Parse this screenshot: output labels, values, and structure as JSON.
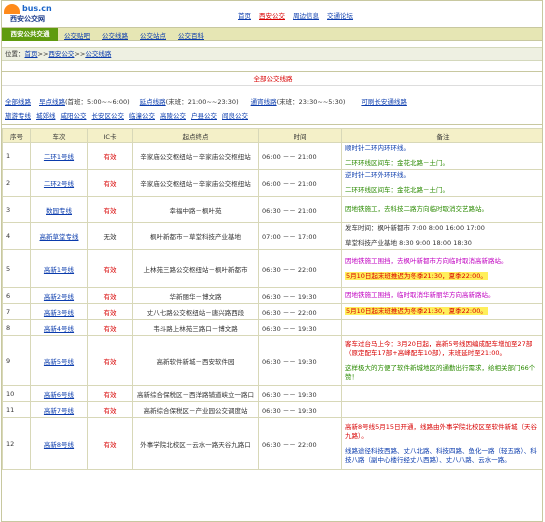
{
  "header": {
    "logo_domain": "bus.cn",
    "logo_name": "西安公交网",
    "nav": [
      "首页",
      "西安公交",
      "周边信息",
      "交通论坛"
    ],
    "nav_active_index": 1
  },
  "subbar": {
    "site_tab": "西安公共交通",
    "items": [
      "公交贴吧",
      "公交线路",
      "公交站点",
      "公交百科"
    ]
  },
  "breadcrumb": {
    "prefix": "位置：",
    "items": [
      "首页",
      "西安公交",
      "公交线路"
    ],
    "sep": ">>"
  },
  "all_lines": {
    "title": "全部公交线路",
    "categories": [
      {
        "link": "全部线路",
        "note": ""
      },
      {
        "link": "早点线路",
        "note": "(首班：5:00~~6:00)"
      },
      {
        "link": "延点线路",
        "note": "(末班：21:00~~23:30)"
      },
      {
        "link": "通宵线路",
        "note": "(末班：23:30~~5:30)"
      },
      {
        "link": "可刷长安通线路",
        "note": ""
      }
    ],
    "districts": [
      "旅游专线",
      "城郊线",
      "咸阳公交",
      "长安区公交",
      "临潼公交",
      "高陵公交",
      "户县公交",
      "阎良公交"
    ]
  },
  "table": {
    "headers": [
      "序号",
      "车次",
      "IC卡",
      "起点终点",
      "时间",
      "备注"
    ],
    "rows": [
      {
        "no": "1",
        "line": "二环1号线",
        "ic": "有效",
        "route": "辛家庙公交枢纽站－辛家庙公交枢纽站",
        "time": "06:00 －－ 21:00",
        "notes": [
          [
            {
              "t": "顺时针二环内环环线。",
              "c": "b"
            }
          ],
          [
            {
              "t": "二环环线区间车：金花北路－土门。",
              "c": "g"
            }
          ]
        ]
      },
      {
        "no": "2",
        "line": "二环2号线",
        "ic": "有效",
        "route": "辛家庙公交枢纽站－辛家庙公交枢纽站",
        "time": "06:00 －－ 21:00",
        "notes": [
          [
            {
              "t": "逆时针二环外环环线。",
              "c": "b"
            }
          ],
          [
            {
              "t": "二环环线区间车：金花北路－土门。",
              "c": "g"
            }
          ]
        ]
      },
      {
        "no": "3",
        "line": "数园专线",
        "ic": "有效",
        "route": "幸福中路－枫叶苑",
        "time": "06:30 －－ 21:00",
        "notes": [
          [
            {
              "t": "因地铁施工，去科技二路方向临时取消交艺路站。",
              "c": "g"
            }
          ]
        ]
      },
      {
        "no": "4",
        "line": "高新草堂专线",
        "ic": "无效",
        "route": "枫叶新都市－草堂科技产业基地",
        "time": "07:00 －－ 17:00",
        "notes": [
          [
            {
              "t": "发车时间：枫叶新都市 7:00 8:00 16:00 17:00",
              "c": ""
            }
          ],
          [
            {
              "t": "草堂科技产业基地 8:30 9:00 18:00 18:30",
              "c": ""
            }
          ]
        ]
      },
      {
        "no": "5",
        "line": "高新1号线",
        "ic": "有效",
        "route": "上林苑三路公交枢纽站－枫叶新都市",
        "time": "06:30 －－ 22:00",
        "notes": [
          [
            {
              "t": "因地铁施工围挡，去枫叶新都市方向临时取消高新路站。",
              "c": "m"
            }
          ],
          [
            {
              "t": "5月10日起末班推迟为冬季21:30，夏季22:00。",
              "c": "hl"
            }
          ]
        ]
      },
      {
        "no": "6",
        "line": "高新2号线",
        "ic": "有效",
        "route": "华新丽华－博文路",
        "time": "06:30 －－ 19:30",
        "notes": [
          [
            {
              "t": "因地铁施工围挡，临时取消华新丽华方向高新路站。",
              "c": "m"
            }
          ]
        ]
      },
      {
        "no": "7",
        "line": "高新3号线",
        "ic": "有效",
        "route": "丈八七路公交枢纽站－唐兴路西段",
        "time": "06:30 －－ 22:00",
        "notes": [
          [
            {
              "t": "5月10日起末班推迟为冬季21:30，夏季22:00。",
              "c": "hl"
            }
          ]
        ]
      },
      {
        "no": "8",
        "line": "高新4号线",
        "ic": "有效",
        "route": "韦斗路上林苑三路口－博文路",
        "time": "06:30 －－ 19:30",
        "notes": []
      },
      {
        "no": "9",
        "line": "高新5号线",
        "ic": "有效",
        "route": "高新软件新城－西安软件园",
        "time": "06:30 －－ 19:30",
        "notes": [
          [
            {
              "t": "客车过台马上今：3月20日起，高新5号线因编成配车增加至27部（原定配车17部+高峰配车10部），末班延时至21:00。",
              "c": "n"
            }
          ],
          [
            {
              "t": "这样极大的方便了软件新城地区的通勤出行需求，给相关部门66个赞！",
              "c": "g"
            }
          ]
        ]
      },
      {
        "no": "10",
        "line": "高新6号线",
        "ic": "有效",
        "route": "高新综合保税区－西洋路铺道峡立一路口",
        "time": "06:30 －－ 19:30",
        "notes": []
      },
      {
        "no": "11",
        "line": "高新7号线",
        "ic": "有效",
        "route": "高新综合保税区－产业园公交调度站",
        "time": "06:30 －－ 19:30",
        "notes": []
      },
      {
        "no": "12",
        "line": "高新8号线",
        "ic": "有效",
        "route": "外事学院北校区－云水一路天谷九路口",
        "time": "06:30 －－ 22:00",
        "notes": [
          [
            {
              "t": "高新8号线5月15日开通，线路由外事学院北校区至软件新城（天谷九路）。",
              "c": "n"
            }
          ],
          [
            {
              "t": "线路途径科技西路、丈八北路、科技四路、鱼化一路（轻五路）、科技八路（副中心楼行经丈八西路）、丈八八路、云水一路。",
              "c": "b"
            }
          ]
        ]
      }
    ]
  }
}
